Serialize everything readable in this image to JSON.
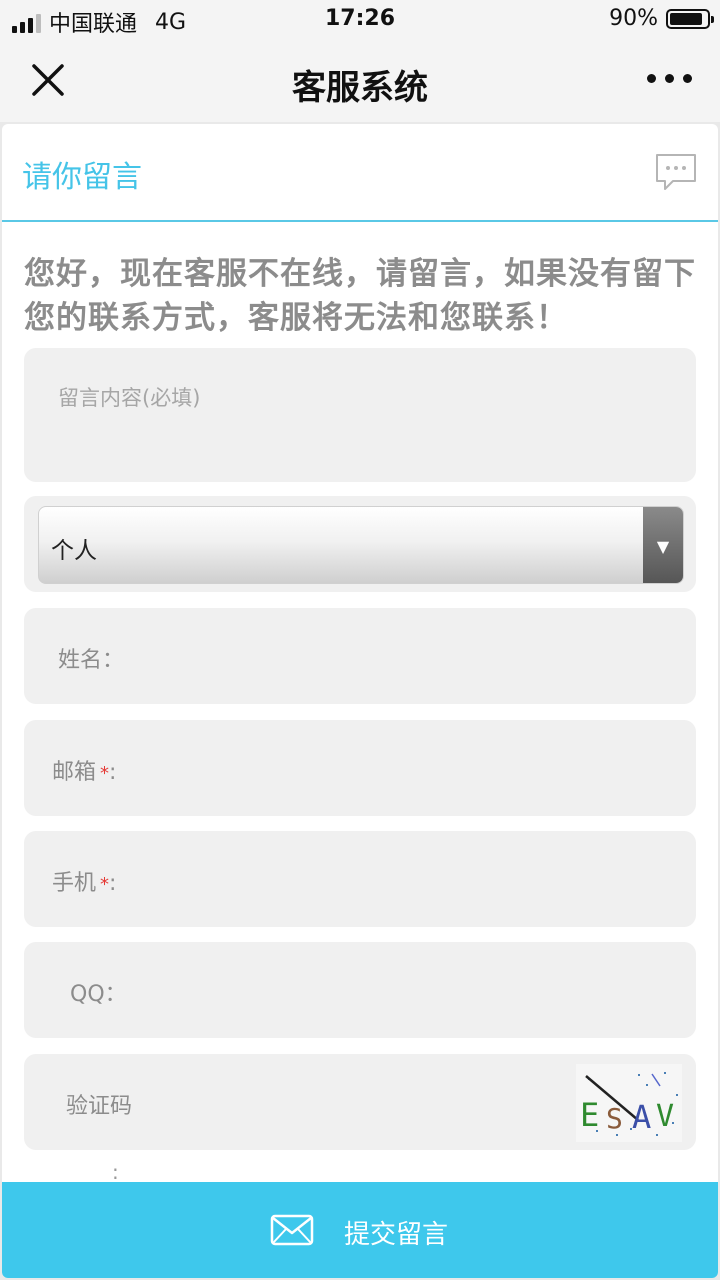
{
  "status_bar": {
    "carrier": "中国联通",
    "network": "4G",
    "time": "17:26",
    "battery": "90%",
    "battery_level": 0.9
  },
  "nav": {
    "title": "客服系统"
  },
  "panel": {
    "title": "请你留言",
    "notice": "您好，现在客服不在线，请留言，如果没有留下您的联系方式，客服将无法和您联系！"
  },
  "form": {
    "message_placeholder": "留言内容(必填)",
    "type_selected": "个人",
    "name_label": "姓名：",
    "email_label": "邮箱",
    "phone_label": "手机",
    "required_mark": "*",
    "label_colon": ":",
    "qq_label": "QQ：",
    "captcha_label": "验证码",
    "captcha_text": "ESAV",
    "stray_colon": ":"
  },
  "submit": {
    "label": "提交留言"
  },
  "colors": {
    "accent": "#45c4e8",
    "submit_bg": "#3ec8ec",
    "required": "#e53935"
  }
}
